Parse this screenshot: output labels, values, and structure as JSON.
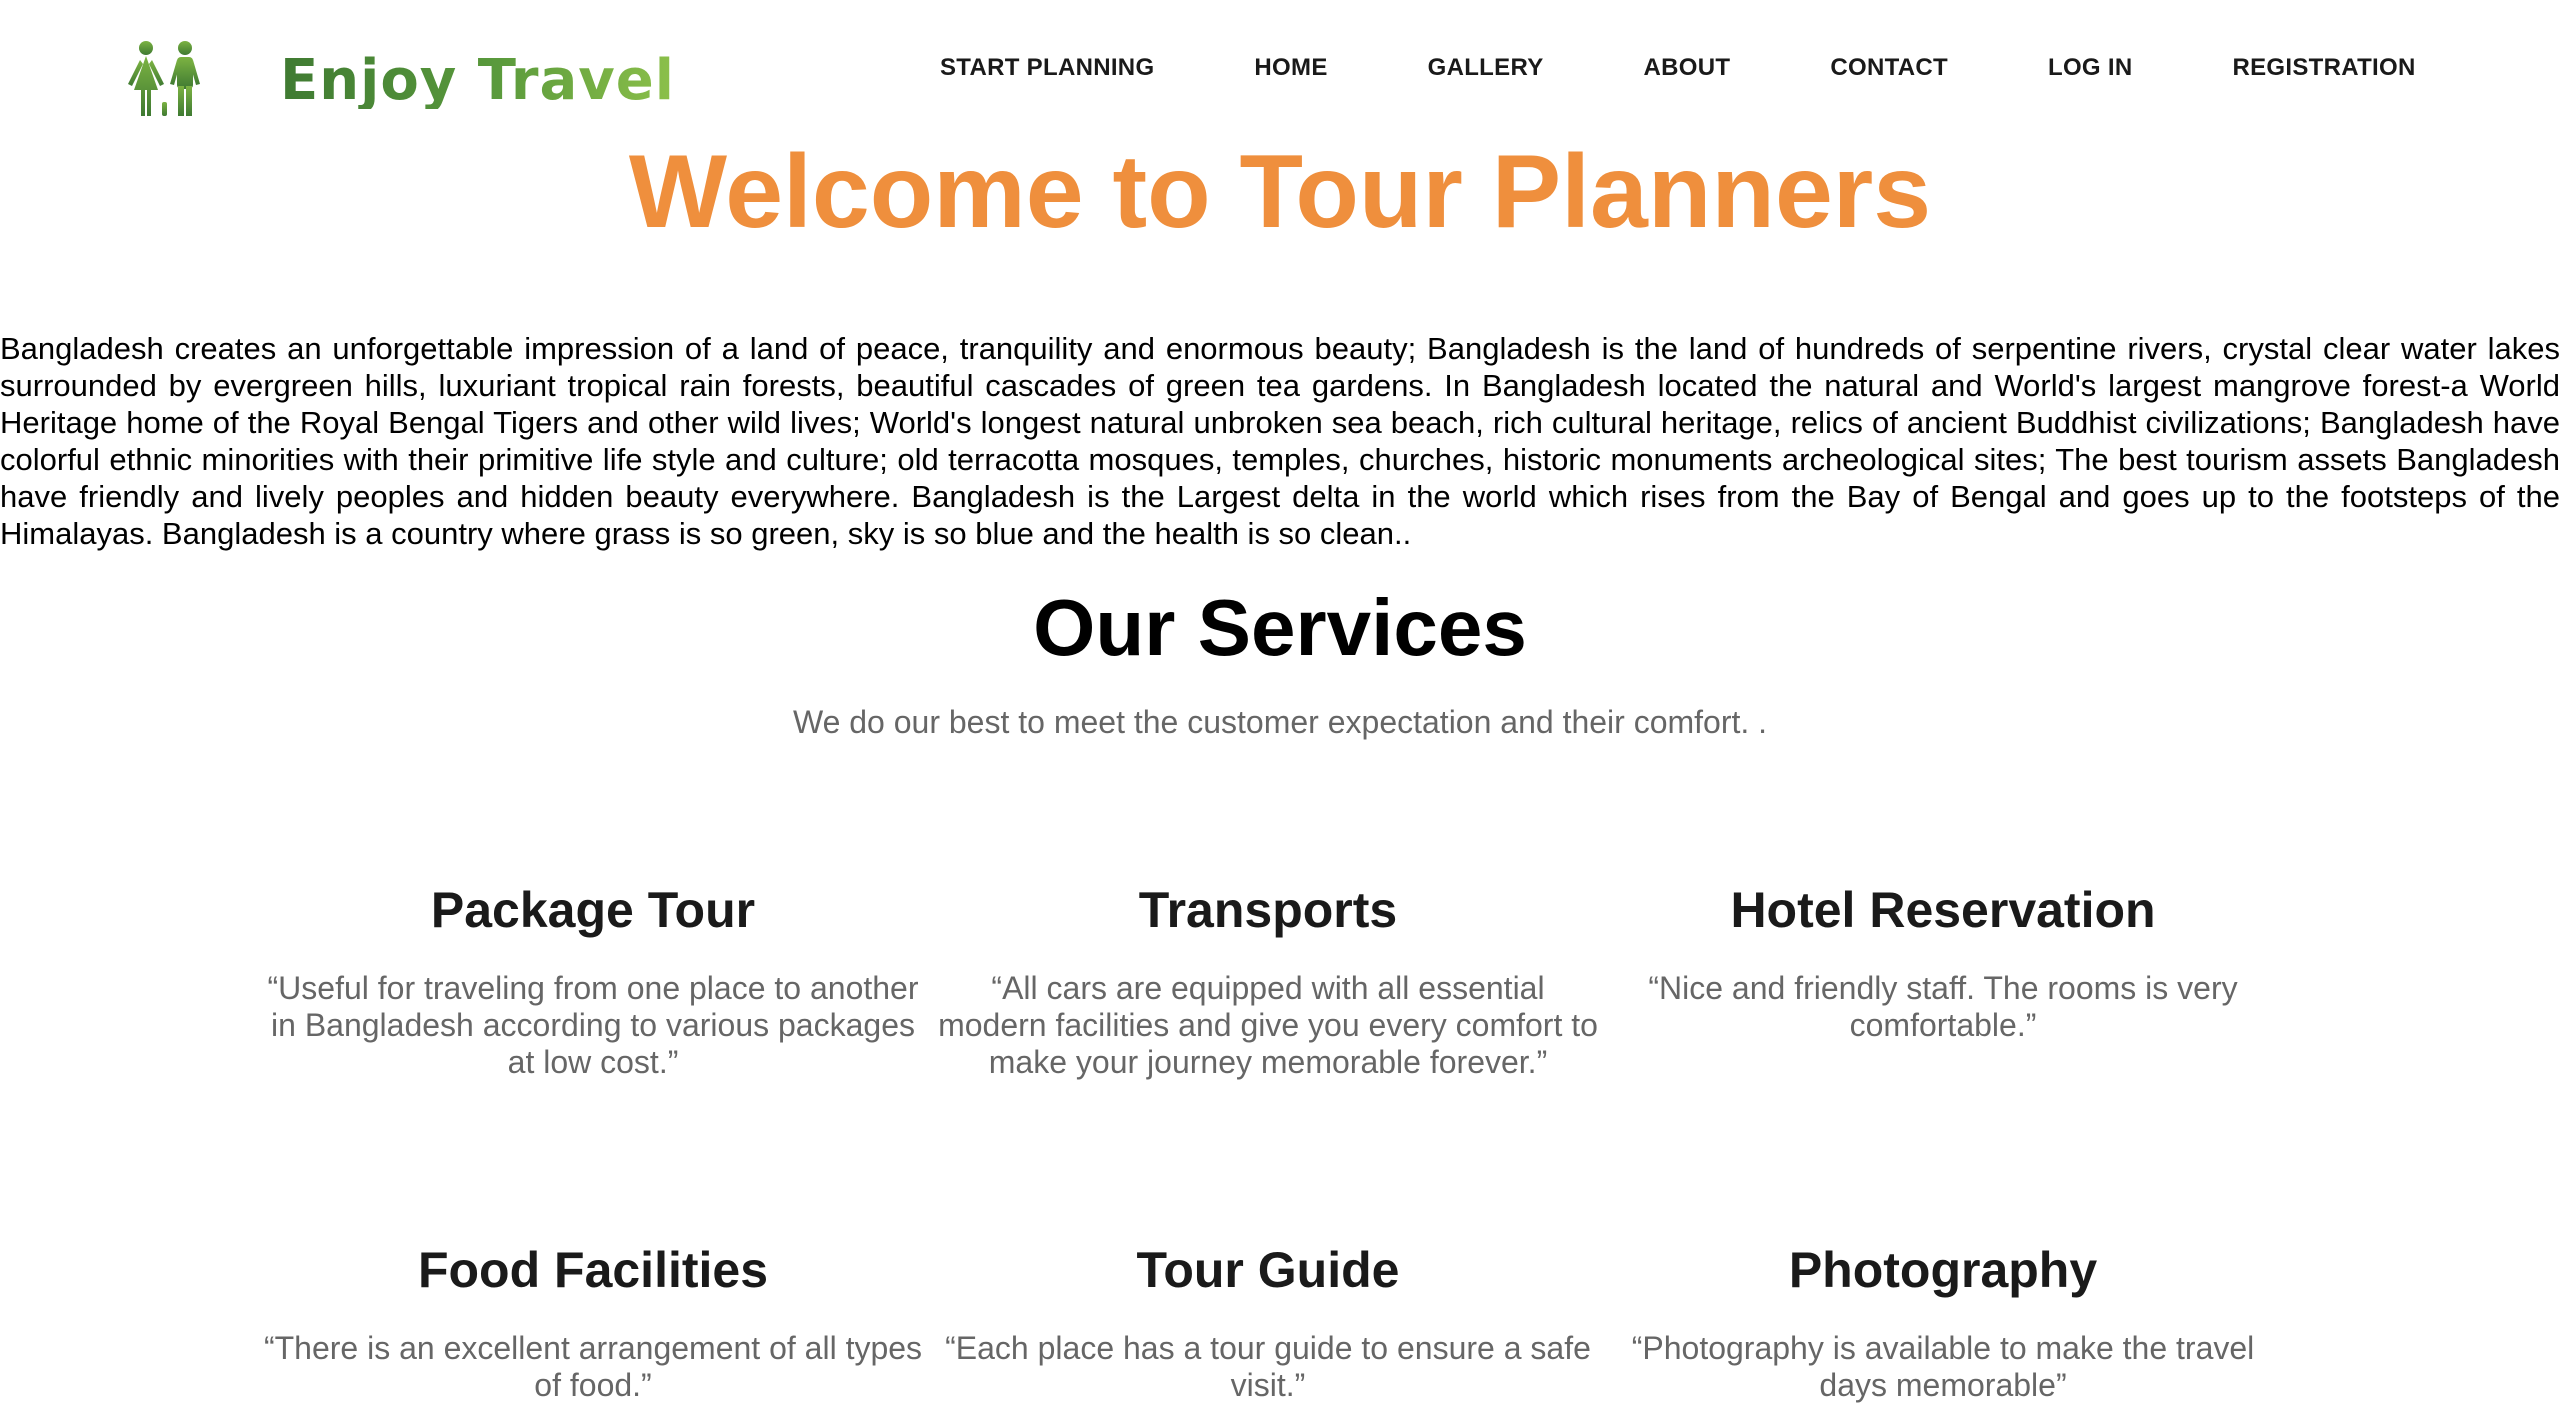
{
  "brand": {
    "name": "Enjoy Travel",
    "logo_icon": "two-people-icon",
    "color_dark": "#3f7a32",
    "color_light": "#8cc04a"
  },
  "nav": {
    "items": [
      {
        "label": "START PLANNING"
      },
      {
        "label": "HOME"
      },
      {
        "label": "GALLERY"
      },
      {
        "label": "ABOUT"
      },
      {
        "label": "CONTACT"
      },
      {
        "label": "LOG IN"
      },
      {
        "label": "REGISTRATION"
      }
    ]
  },
  "hero": {
    "title": "Welcome to Tour Planners",
    "title_color": "#ef8f3d",
    "intro": "Bangladesh creates an unforgettable impression of a land of peace, tranquility and enormous beauty; Bangladesh is the land of hundreds of serpentine rivers, crystal clear water lakes surrounded by evergreen hills, luxuriant tropical rain forests, beautiful cascades of green tea gardens. In Bangladesh located the natural and World's largest mangrove forest-a World Heritage home of the Royal Bengal Tigers and other wild lives; World's longest natural unbroken sea beach, rich cultural heritage, relics of ancient Buddhist civilizations; Bangladesh have colorful ethnic minorities with their primitive life style and culture; old terracotta mosques, temples, churches, historic monuments archeological sites; The best tourism assets Bangladesh have friendly and lively peoples and hidden beauty everywhere. Bangladesh is the Largest delta in the world which rises from the Bay of Bengal and goes up to the footsteps of the Himalayas. Bangladesh is a country where grass is so green, sky is so blue and the health is so clean.."
  },
  "services": {
    "title": "Our Services",
    "subtitle": "We do our best to meet the customer expectation and their comfort. .",
    "items": [
      {
        "title": "Package Tour",
        "text": "“Useful for traveling from one place to another in Bangladesh according to various packages at low cost.”"
      },
      {
        "title": "Transports",
        "text": "“All cars are equipped with all essential modern facilities and give you every comfort to make your journey memorable forever.”"
      },
      {
        "title": "Hotel Reservation",
        "text": "“Nice and friendly staff. The rooms is very comfortable.”"
      },
      {
        "title": "Food Facilities",
        "text": "“There is an excellent arrangement of all types of food.”"
      },
      {
        "title": "Tour Guide",
        "text": "“Each place has a tour guide to ensure a safe visit.”"
      },
      {
        "title": "Photography",
        "text": "“Photography is available to make the travel days memorable”"
      }
    ]
  }
}
